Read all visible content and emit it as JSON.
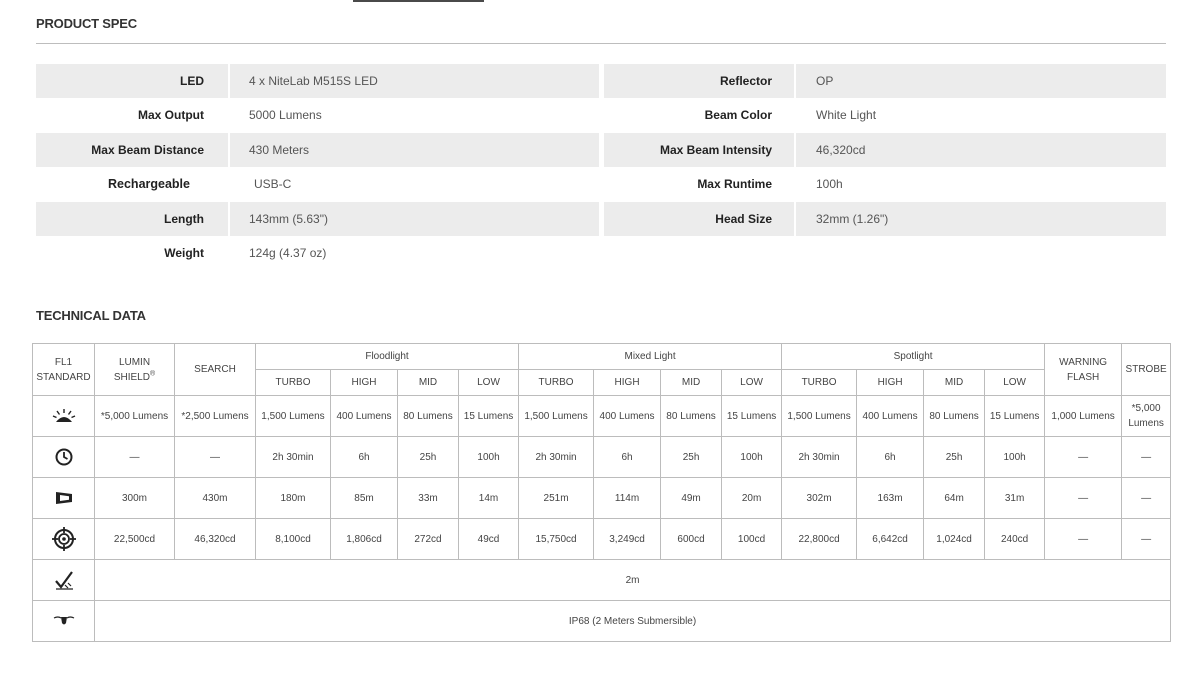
{
  "spec": {
    "title": "PRODUCT SPEC",
    "rows": [
      {
        "left": {
          "key": "LED",
          "value": "4 x NiteLab M515S LED"
        },
        "right": {
          "key": "Reflector",
          "value": "OP"
        }
      },
      {
        "left": {
          "key": "Max Output",
          "value": "5000 Lumens"
        },
        "right": {
          "key": "Beam Color",
          "value": "White Light"
        }
      },
      {
        "left": {
          "key": "Max Beam Distance",
          "value": "430 Meters"
        },
        "right": {
          "key": "Max Beam Intensity",
          "value": "46,320cd"
        }
      },
      {
        "left": {
          "key": "Rechargeable",
          "value": "USB-C"
        },
        "right": {
          "key": "Max Runtime",
          "value": "100h"
        }
      },
      {
        "left": {
          "key": "Length",
          "value": "143mm (5.63\")"
        },
        "right": {
          "key": "Head Size",
          "value": "32mm (1.26\")"
        }
      },
      {
        "left": {
          "key": "Weight",
          "value": "124g (4.37 oz)"
        }
      }
    ]
  },
  "tech": {
    "title": "TECHNICAL DATA",
    "headers": {
      "fl1_line1": "FL1",
      "fl1_line2": "STANDARD",
      "lumin_line1": "LUMIN",
      "lumin_line2": "SHIELD",
      "lumin_mark": "®",
      "search": "SEARCH",
      "floodlight": "Floodlight",
      "mixed": "Mixed Light",
      "spotlight": "Spotlight",
      "warning_line1": "WARNING",
      "warning_line2": "FLASH",
      "strobe": "STROBE",
      "modes": [
        "TURBO",
        "HIGH",
        "MID",
        "LOW"
      ]
    },
    "icons": [
      "output-icon",
      "runtime-icon",
      "distance-icon",
      "intensity-icon",
      "impact-icon",
      "waterproof-icon"
    ],
    "output": [
      "*5,000 Lumens",
      "*2,500 Lumens",
      "1,500 Lumens",
      "400 Lumens",
      "80 Lumens",
      "15 Lumens",
      "1,500 Lumens",
      "400 Lumens",
      "80 Lumens",
      "15 Lumens",
      "1,500 Lumens",
      "400 Lumens",
      "80 Lumens",
      "15 Lumens",
      "1,000 Lumens"
    ],
    "output_strobe_line1": "*5,000",
    "output_strobe_line2": "Lumens",
    "runtime": [
      "—",
      "—",
      "2h 30min",
      "6h",
      "25h",
      "100h",
      "2h 30min",
      "6h",
      "25h",
      "100h",
      "2h 30min",
      "6h",
      "25h",
      "100h",
      "—",
      "—"
    ],
    "distance": [
      "300m",
      "430m",
      "180m",
      "85m",
      "33m",
      "14m",
      "251m",
      "114m",
      "49m",
      "20m",
      "302m",
      "163m",
      "64m",
      "31m",
      "—",
      "—"
    ],
    "intensity": [
      "22,500cd",
      "46,320cd",
      "8,100cd",
      "1,806cd",
      "272cd",
      "49cd",
      "15,750cd",
      "3,249cd",
      "600cd",
      "100cd",
      "22,800cd",
      "6,642cd",
      "1,024cd",
      "240cd",
      "—",
      "—"
    ],
    "impact": "2m",
    "waterproof": "IP68 (2 Meters Submersible)"
  }
}
